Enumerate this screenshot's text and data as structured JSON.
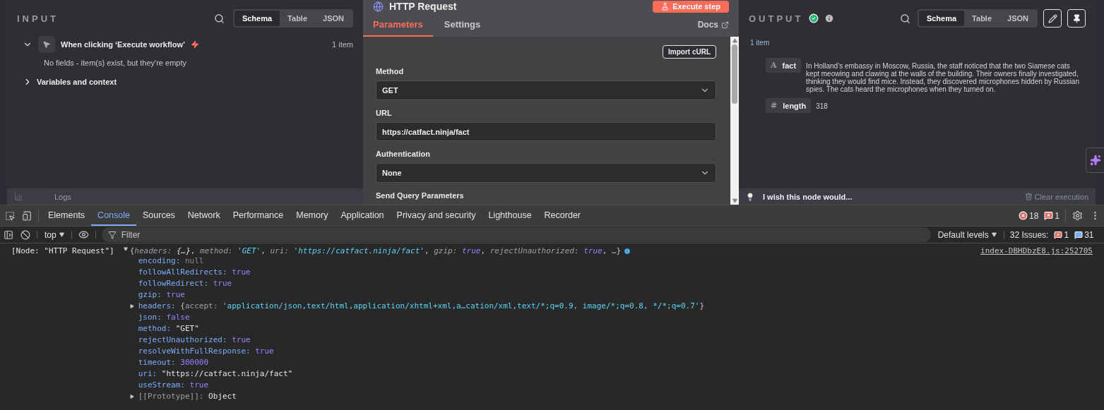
{
  "input_panel": {
    "title": "INPUT",
    "view_tabs": [
      {
        "label": "Schema",
        "selected": true
      },
      {
        "label": "Table",
        "selected": false
      },
      {
        "label": "JSON",
        "selected": false
      }
    ],
    "trigger": {
      "name": "When clicking ‘Execute workflow’",
      "count": "1 item",
      "expanded": true,
      "message": "No fields - item(s) exist, but they're empty"
    },
    "sections": [
      {
        "label": "Variables and context",
        "expanded": false
      }
    ]
  },
  "logs_bar": {
    "label": "Logs"
  },
  "node_panel": {
    "title": "HTTP Request",
    "execute_button": "Execute step",
    "tabs": [
      {
        "label": "Parameters",
        "selected": true
      },
      {
        "label": "Settings",
        "selected": false
      }
    ],
    "docs_link": "Docs",
    "import_button": "Import cURL",
    "fields": [
      {
        "kind": "select",
        "label": "Method",
        "value": "GET"
      },
      {
        "kind": "text",
        "label": "URL",
        "value": "https://catfact.ninja/fact"
      },
      {
        "kind": "select",
        "label": "Authentication",
        "value": "None"
      },
      {
        "kind": "heading",
        "label": "Send Query Parameters"
      }
    ]
  },
  "output_panel": {
    "title": "OUTPUT",
    "succeeded": true,
    "view_tabs": [
      {
        "label": "Schema",
        "selected": true
      },
      {
        "label": "Table",
        "selected": false
      },
      {
        "label": "JSON",
        "selected": false
      }
    ],
    "count": "1 item",
    "fields": [
      {
        "type_icon": "A",
        "name": "fact",
        "value": "In Holland’s embassy in Moscow, Russia, the staff noticed that the two Siamese cats kept meowing and clawing at the walls of the building. Their owners finally investigated, thinking they would find mice. Instead, they discovered microphones hidden by Russian spies. The cats heard the microphones when they turned on."
      },
      {
        "type_icon": "#",
        "name": "length",
        "value": "318"
      }
    ]
  },
  "feedback_bar": {
    "label": "I wish this node would...",
    "clear_button": "Clear execution"
  },
  "devtools": {
    "tabs": [
      {
        "label": "Elements",
        "selected": false
      },
      {
        "label": "Console",
        "selected": true
      },
      {
        "label": "Sources",
        "selected": false
      },
      {
        "label": "Network",
        "selected": false
      },
      {
        "label": "Performance",
        "selected": false
      },
      {
        "label": "Memory",
        "selected": false
      },
      {
        "label": "Application",
        "selected": false
      },
      {
        "label": "Privacy and security",
        "selected": false
      },
      {
        "label": "Lighthouse",
        "selected": false
      },
      {
        "label": "Recorder",
        "selected": false
      }
    ],
    "error_count": "18",
    "warning_count": "1",
    "context": "top",
    "filter_placeholder": "Filter",
    "levels": "Default levels",
    "issues_label": "32 Issues:",
    "issues_errors": "1",
    "issues_info": "31",
    "console": {
      "source": "[Node: \"HTTP Request\"]",
      "link": "index-DBHDbzE8.js:252705",
      "expanded": true,
      "summary": [
        {
          "t": "{",
          "kind": "p"
        },
        {
          "t": "headers: ",
          "kind": "key"
        },
        {
          "t": "{…}",
          "kind": "plain"
        },
        {
          "t": ", ",
          "kind": "p"
        },
        {
          "t": "method: ",
          "kind": "key"
        },
        {
          "t": "'GET'",
          "kind": "str"
        },
        {
          "t": ", ",
          "kind": "p"
        },
        {
          "t": "uri: ",
          "kind": "key"
        },
        {
          "t": "'https://catfact.ninja/fact'",
          "kind": "str"
        },
        {
          "t": ", ",
          "kind": "p"
        },
        {
          "t": "gzip: ",
          "kind": "key"
        },
        {
          "t": "true",
          "kind": "bool"
        },
        {
          "t": ", ",
          "kind": "p"
        },
        {
          "t": "rejectUnauthorized: ",
          "kind": "key"
        },
        {
          "t": "true",
          "kind": "bool"
        },
        {
          "t": ", …}",
          "kind": "p"
        }
      ],
      "properties": [
        {
          "key": "encoding:",
          "expandable": false,
          "value": [
            {
              "t": "null",
              "kind": "null"
            }
          ]
        },
        {
          "key": "followAllRedirects:",
          "expandable": false,
          "value": [
            {
              "t": "true",
              "kind": "bool"
            }
          ]
        },
        {
          "key": "followRedirect:",
          "expandable": false,
          "value": [
            {
              "t": "true",
              "kind": "bool"
            }
          ]
        },
        {
          "key": "gzip:",
          "expandable": false,
          "value": [
            {
              "t": "true",
              "kind": "bool"
            }
          ]
        },
        {
          "key": "headers:",
          "expandable": true,
          "value": [
            {
              "t": "{",
              "kind": "p"
            },
            {
              "t": "accept: ",
              "kind": "key"
            },
            {
              "t": "'application/json,text/html,application/xhtml+xml,a…cation/xml,text/*;q=0.9, image/*;q=0.8, */*;q=0.7'",
              "kind": "str"
            },
            {
              "t": "}",
              "kind": "p"
            }
          ]
        },
        {
          "key": "json:",
          "expandable": false,
          "value": [
            {
              "t": "false",
              "kind": "bool"
            }
          ]
        },
        {
          "key": "method:",
          "expandable": false,
          "value": [
            {
              "t": "\"GET\"",
              "kind": "plain"
            }
          ]
        },
        {
          "key": "rejectUnauthorized:",
          "expandable": false,
          "value": [
            {
              "t": "true",
              "kind": "bool"
            }
          ]
        },
        {
          "key": "resolveWithFullResponse:",
          "expandable": false,
          "value": [
            {
              "t": "true",
              "kind": "bool"
            }
          ]
        },
        {
          "key": "timeout:",
          "expandable": false,
          "value": [
            {
              "t": "300000",
              "kind": "num"
            }
          ]
        },
        {
          "key": "uri:",
          "expandable": false,
          "value": [
            {
              "t": "\"https://catfact.ninja/fact\"",
              "kind": "plain"
            }
          ]
        },
        {
          "key": "useStream:",
          "expandable": false,
          "value": [
            {
              "t": "true",
              "kind": "bool"
            }
          ]
        },
        {
          "key": "[[Prototype]]:",
          "kind": "internal",
          "expandable": true,
          "value": [
            {
              "t": "Object",
              "kind": "plain"
            }
          ]
        }
      ]
    }
  }
}
